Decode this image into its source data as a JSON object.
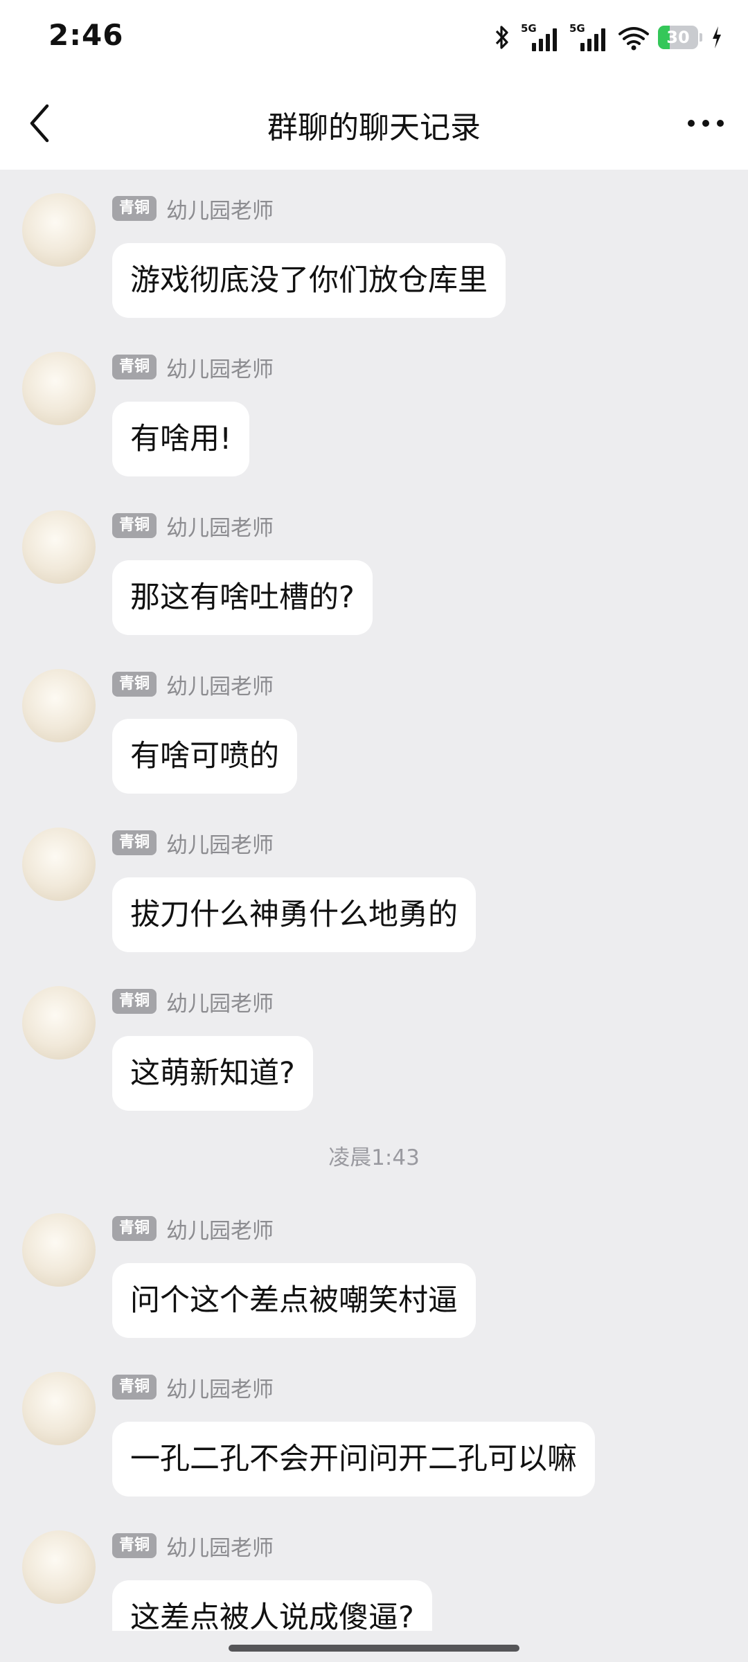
{
  "status_bar": {
    "time": "2:46",
    "network_label_1": "5G",
    "network_label_2": "5G",
    "battery_level": "30",
    "battery_fraction": 0.3,
    "battery_color": "#34c759",
    "icons": [
      "bluetooth-icon",
      "signal-icon",
      "signal-icon",
      "wifi-icon",
      "battery-icon",
      "charging-icon"
    ]
  },
  "header": {
    "back_icon": "chevron-left-icon",
    "title": "群聊的聊天记录",
    "more_icon": "more-horizontal-icon"
  },
  "chat": {
    "group1": [
      {
        "badge": "青铜",
        "sender": "幼儿园老师",
        "text": "游戏彻底没了你们放仓库里"
      },
      {
        "badge": "青铜",
        "sender": "幼儿园老师",
        "text": "有啥用!"
      },
      {
        "badge": "青铜",
        "sender": "幼儿园老师",
        "text": "那这有啥吐槽的?"
      },
      {
        "badge": "青铜",
        "sender": "幼儿园老师",
        "text": "有啥可喷的"
      },
      {
        "badge": "青铜",
        "sender": "幼儿园老师",
        "text": "拔刀什么神勇什么地勇的"
      },
      {
        "badge": "青铜",
        "sender": "幼儿园老师",
        "text": "这萌新知道?"
      }
    ],
    "divider_time": "凌晨1:43",
    "group2": [
      {
        "badge": "青铜",
        "sender": "幼儿园老师",
        "text": "问个这个差点被嘲笑村逼"
      },
      {
        "badge": "青铜",
        "sender": "幼儿园老师",
        "text": "一孔二孔不会开问问开二孔可以嘛"
      },
      {
        "badge": "青铜",
        "sender": "幼儿园老师",
        "text": "这差点被人说成傻逼?"
      }
    ]
  },
  "colors": {
    "background": "#ededef",
    "bubble": "#ffffff",
    "badge": "#a4a4a8",
    "sender": "#8c8c90"
  }
}
